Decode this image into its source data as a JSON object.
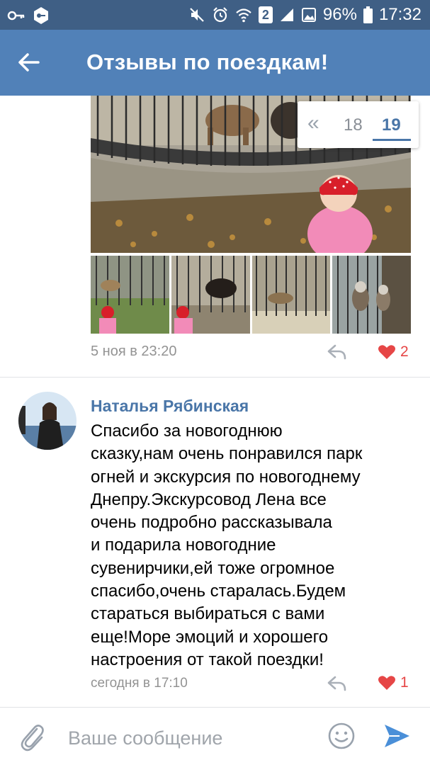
{
  "status_bar": {
    "battery_percent": "96%",
    "time": "17:32",
    "sim_badge": "2"
  },
  "header": {
    "title": "Отзывы по поездкам!"
  },
  "pager": {
    "prev_label": "«",
    "pages": [
      "18",
      "19"
    ],
    "current_page": "19"
  },
  "post1": {
    "timestamp": "5 ноя в 23:20",
    "likes": "2"
  },
  "comment": {
    "author": "Наталья Рябинская",
    "text_lines": [
      "Спасибо за новогоднюю",
      "сказку,нам очень понравился парк",
      "огней и экскурсия по новогоднему",
      "Днепру.Экскурсовод Лена все",
      "очень подробно рассказывала",
      "и подарила новогодние",
      "сувенирчики,ей тоже огромное",
      "спасибо,очень старалась.Будем",
      "стараться выбираться с вами",
      "еще!Море эмоций и хорошего",
      "настроения от такой поездки!"
    ],
    "timestamp": "сегодня в 17:10",
    "likes": "1"
  },
  "composer": {
    "placeholder": "Ваше сообщение"
  },
  "colors": {
    "status_bar": "#3f5f85",
    "header": "#5181b8",
    "accent": "#4a76a8",
    "like": "#e64646"
  }
}
